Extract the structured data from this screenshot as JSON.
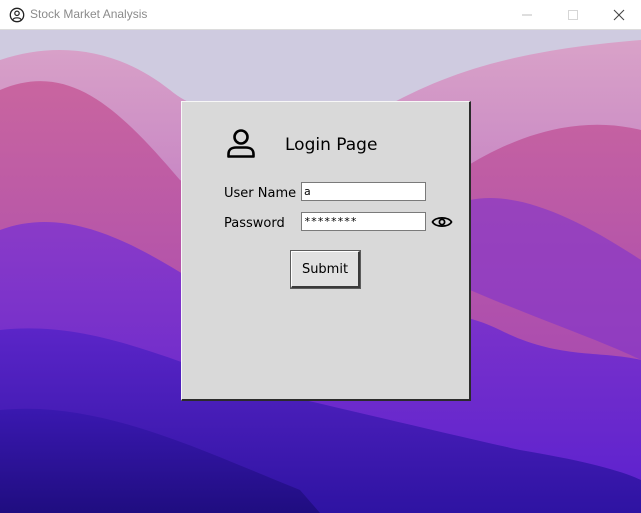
{
  "window": {
    "title": "Stock Market Analysis",
    "controls": [
      "minimize",
      "maximize",
      "close"
    ]
  },
  "login": {
    "title": "Login Page",
    "username_label": "User Name",
    "username_value": "a",
    "password_label": "Password",
    "password_value": "********",
    "submit_label": "Submit"
  },
  "icons": {
    "app": "user-circle-icon",
    "header": "user-icon",
    "password_toggle": "eye-icon"
  },
  "colors": {
    "panel_background": "#d9d9d9",
    "titlebar_background": "#ffffff",
    "wallpaper_top": "#cbc7df",
    "wallpaper_mid": "#b06ab0",
    "wallpaper_bottom": "#2d13a8"
  }
}
